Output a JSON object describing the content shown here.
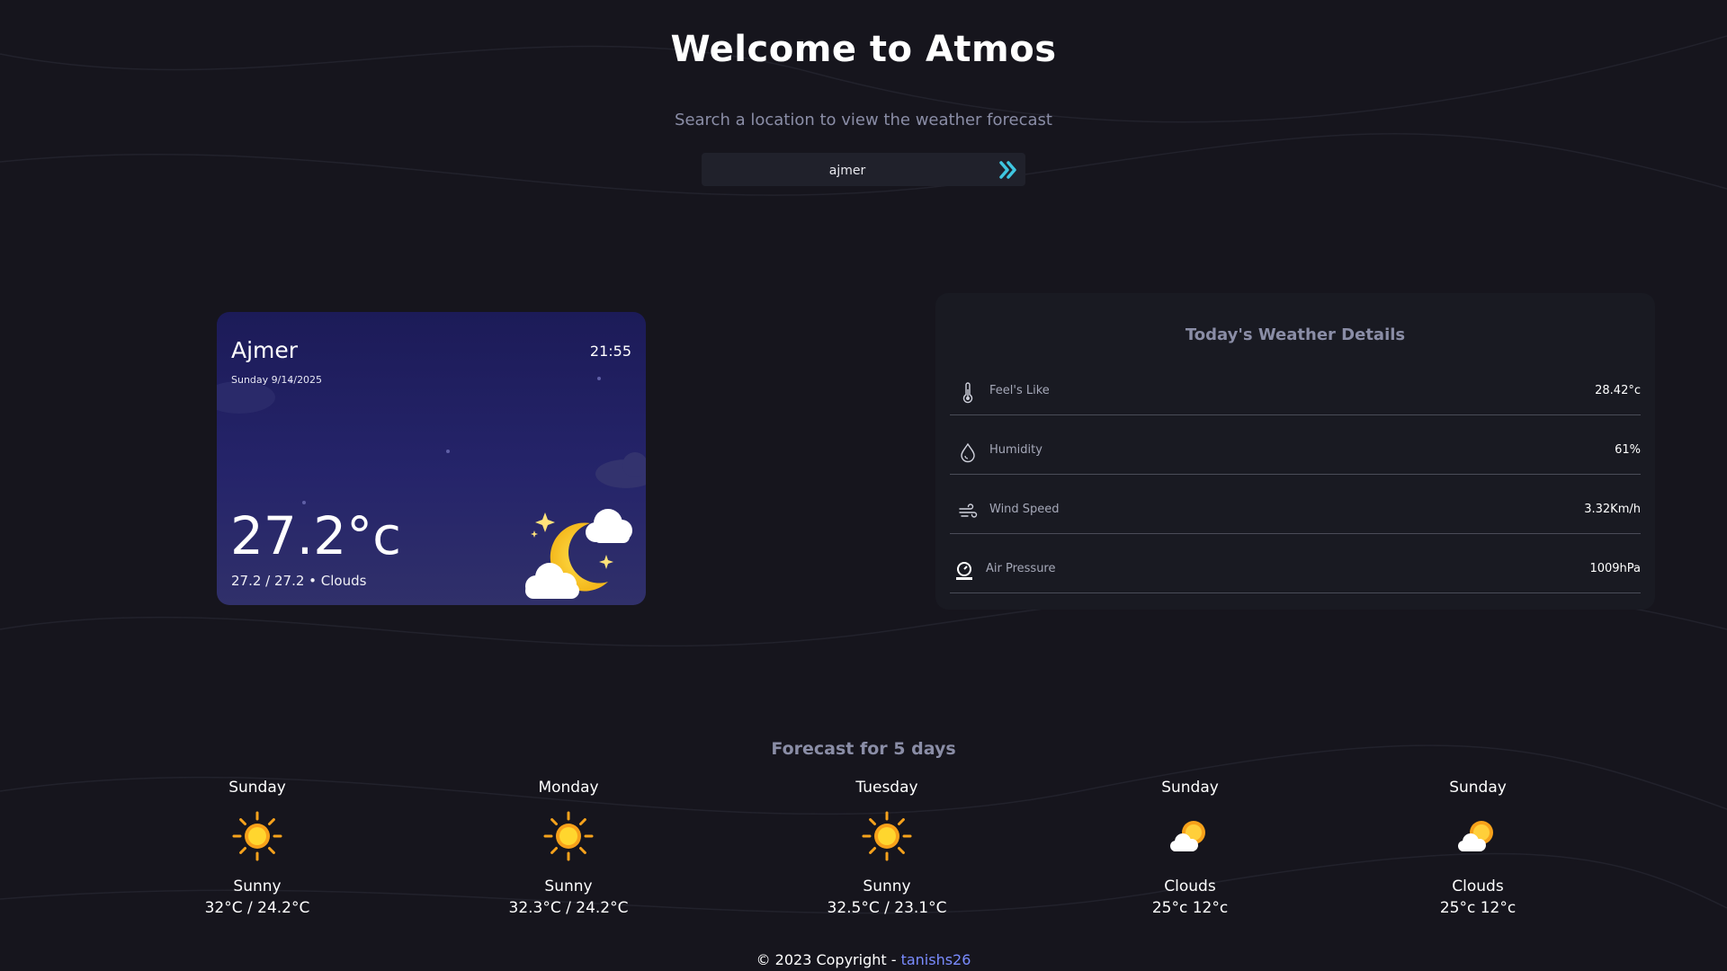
{
  "header": {
    "title": "Welcome to Atmos",
    "subtitle": "Search a location to view the weather forecast"
  },
  "search": {
    "value": "ajmer"
  },
  "current": {
    "city": "Ajmer",
    "time": "21:55",
    "date": "Sunday 9/14/2025",
    "temperature": "27.2°c",
    "summary": "27.2 / 27.2 • Clouds",
    "icon": "moon-cloud-icon"
  },
  "details": {
    "title": "Today's Weather Details",
    "rows": [
      {
        "label": "Feel's Like",
        "value": "28.42°c",
        "icon": "thermometer-icon"
      },
      {
        "label": "Humidity",
        "value": "61%",
        "icon": "droplet-icon"
      },
      {
        "label": "Wind Speed",
        "value": "3.32Km/h",
        "icon": "wind-icon"
      },
      {
        "label": "Air Pressure",
        "value": "1009hPa",
        "icon": "pressure-gauge-icon"
      }
    ]
  },
  "forecast": {
    "title": "Forecast for 5 days",
    "days": [
      {
        "day": "Sunday",
        "desc": "Sunny",
        "range": "32°C / 24.2°C",
        "icon": "sun-icon"
      },
      {
        "day": "Monday",
        "desc": "Sunny",
        "range": "32.3°C / 24.2°C",
        "icon": "sun-icon"
      },
      {
        "day": "Tuesday",
        "desc": "Sunny",
        "range": "32.5°C / 23.1°C",
        "icon": "sun-icon"
      },
      {
        "day": "Sunday",
        "desc": "Clouds",
        "range": "25°c 12°c",
        "icon": "sun-cloud-icon"
      },
      {
        "day": "Sunday",
        "desc": "Clouds",
        "range": "25°c 12°c",
        "icon": "sun-cloud-icon"
      }
    ]
  },
  "footer": {
    "text": "© 2023 Copyright - ",
    "link": "tanishs26"
  },
  "colors": {
    "background": "#16151d",
    "accent": "#3fc6e0",
    "card_top": "#1c1b58",
    "link": "#7a8cff"
  }
}
